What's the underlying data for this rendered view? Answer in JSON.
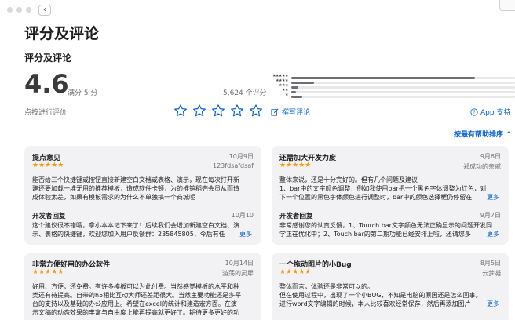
{
  "window": {
    "back_label": "‹"
  },
  "header": {
    "title": "评分及评论",
    "section_title": "评分及评论"
  },
  "rating": {
    "average": "4.6",
    "out_of": "满分 5 分",
    "count": "5,624 个评分",
    "histogram": [
      {
        "stars": 5,
        "fraction": 0.82
      },
      {
        "stars": 4,
        "fraction": 0.1
      },
      {
        "stars": 3,
        "fraction": 0.03
      },
      {
        "stars": 2,
        "fraction": 0.02
      },
      {
        "stars": 1,
        "fraction": 0.05
      }
    ]
  },
  "actions": {
    "tap_label": "点按进行评价:",
    "write_review": "撰写评论",
    "app_support": "App 支持",
    "sort": "按最有帮助排序"
  },
  "colors": {
    "accent": "#0a64d2",
    "star": "#ff9500",
    "card_bg": "#f2f2f4"
  },
  "reviews": [
    {
      "title": "提点意见",
      "date": "10月9日",
      "author": "123fdsafdsaf",
      "stars": "★★★★★",
      "body": [
        "能否给三个快捷键或按钮直接新建空白文档或表格、演示，现在每次打开新",
        "建还要加载一堆无用的推荐模板，造成软件卡顿，为的推销稻壳会员从而造",
        "成体验太差，如果有模板需求的为什么不单独搞一个商城呢"
      ],
      "dev_title": "开发者回复",
      "dev_date": "10月10",
      "dev_body": [
        "这个建议很不错哦，拿小本本记下来了！后续我们会增加新建空白文档、演",
        "示、表格的快捷键，欢迎您加入用户反馈群：235845805，今后有任"
      ],
      "more": "更多"
    },
    {
      "title": "还需加大开发力度",
      "date": "9月6日",
      "author": "郑成功的亲戚",
      "stars": "★★★★★",
      "body": [
        "整体来说，还是十分完好的。但有几个问题及建议",
        "1、bar中的文字颜色调整，例如我使用bar把一个黑色字体调整为红色，对",
        "下一个位置的黑色字体颜色进行调整时，bar中的颜色选择框仍停留在"
      ],
      "more_body": "更多",
      "dev_title": "开发者回复",
      "dev_date": "9月7日",
      "dev_body": [
        "非常感谢您的认真反馈，1、Tourch bar文字颜色无法正确显示的问题开发同",
        "学正在优化中；2、Touch bar的第二期功能已经安排上啦，还请您多"
      ],
      "more": "更多"
    },
    {
      "title": "非常方便好用的办公软件",
      "date": "10月14日",
      "author": "游荡的灵犀",
      "stars": "★★★★★",
      "body": [
        "好用、方便，还免费。有许多模板可以为此付费。当然感觉模板的水平和种",
        "类还有待提高。自带的h5相比互动大师还差距很大。当然主要功能还是多平",
        "台的支持以及基础的办公应用上。希望在excel的统计和建造宏方面。在演",
        "示文稿的动态效果的丰富与自由度上能再提高就更好了。期待更多更好的功"
      ]
    },
    {
      "title": "一个拖动图片的小Bug",
      "date": "8月5日",
      "author": "云梦凝",
      "stars": "★★★★★",
      "body": [
        "整体而言，体验还是非常可以的。",
        "但在使用过程中，出现了一个小BUG，不知是电脑的原因还是怎么回事。",
        "进行word文字编辑的时候，本人比较喜欢经常保存，然后再添加图片"
      ],
      "more": "更多"
    }
  ]
}
